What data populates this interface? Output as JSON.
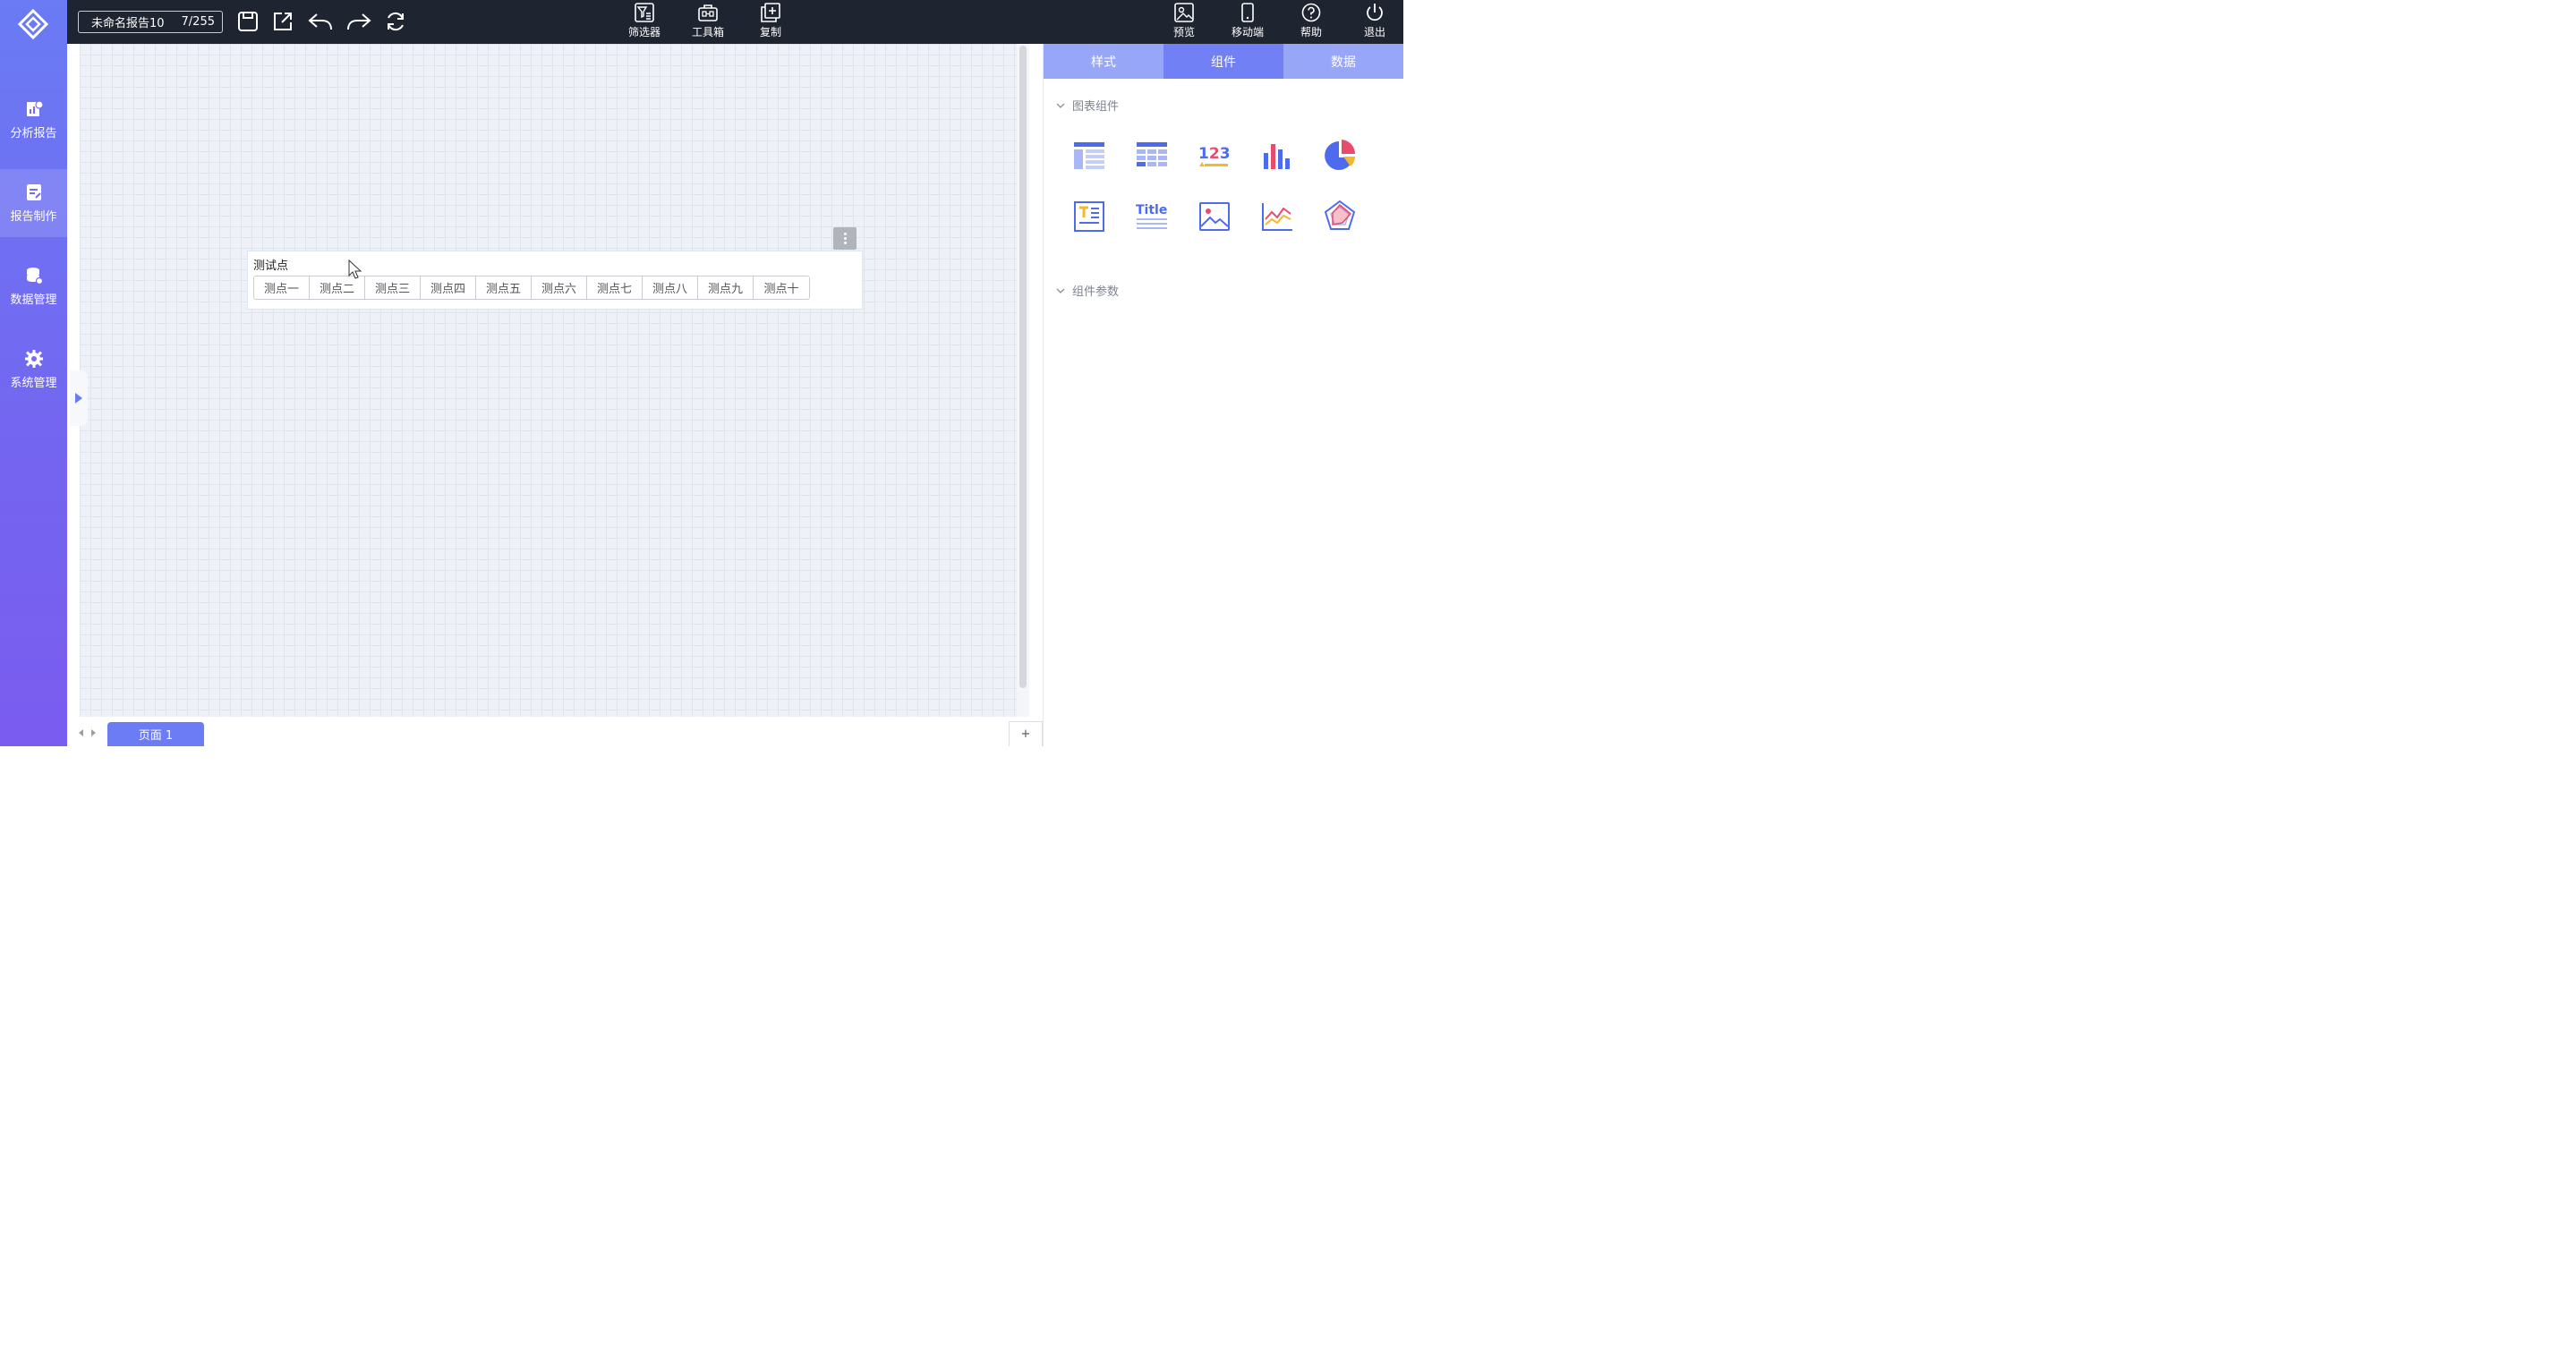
{
  "leftnav": {
    "items": [
      {
        "label": "分析报告"
      },
      {
        "label": "报告制作"
      },
      {
        "label": "数据管理"
      },
      {
        "label": "系统管理"
      }
    ]
  },
  "topbar": {
    "report_name": "未命名报告10",
    "counter": "7/255",
    "tools": [
      {
        "label": "筛选器"
      },
      {
        "label": "工具箱"
      },
      {
        "label": "复制"
      }
    ],
    "right_tools": [
      {
        "label": "预览"
      },
      {
        "label": "移动端"
      },
      {
        "label": "帮助"
      },
      {
        "label": "退出"
      }
    ]
  },
  "canvas": {
    "widget": {
      "title": "测试点",
      "options": [
        "测点一",
        "测点二",
        "测点三",
        "测点四",
        "测点五",
        "测点六",
        "测点七",
        "测点八",
        "测点九",
        "测点十"
      ]
    }
  },
  "pagebar": {
    "page_tab": "页面 1",
    "add": "+"
  },
  "rpanel": {
    "tabs": [
      {
        "label": "样式"
      },
      {
        "label": "组件"
      },
      {
        "label": "数据"
      }
    ],
    "chart_section": "图表组件",
    "param_section": "组件参数",
    "components": [
      "table-detail",
      "table-cross",
      "kpi-number",
      "bar-chart",
      "pie-chart",
      "text-block",
      "title-text",
      "image",
      "line-chart",
      "radar-chart"
    ]
  },
  "colors": {
    "nav_gradient_top": "#6a7bf4",
    "topbar": "#1f2431",
    "tab_active": "#7180f5",
    "tab_inactive": "#98a6f7",
    "accent": "#6c7cf4"
  }
}
